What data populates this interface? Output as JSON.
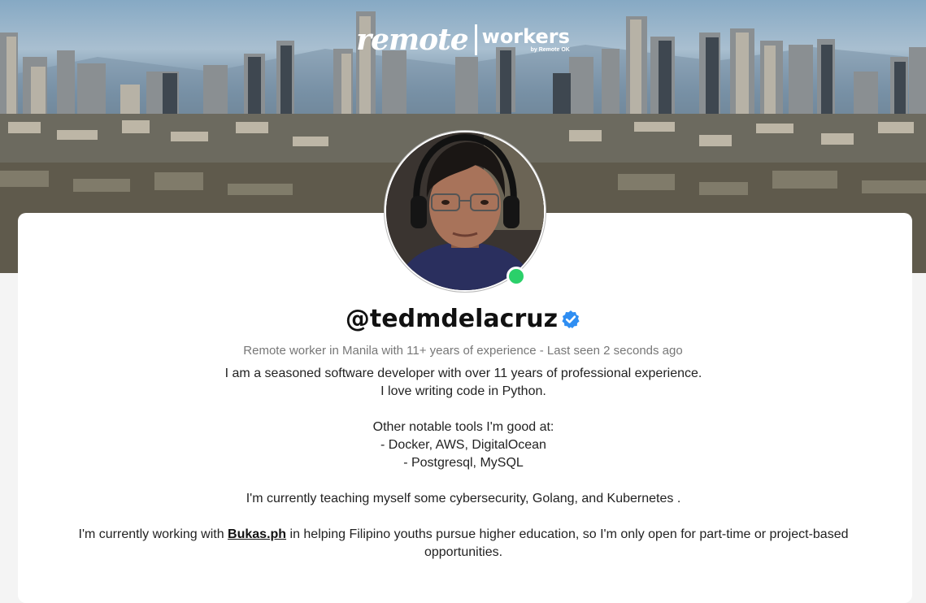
{
  "brand": {
    "remote": "remote",
    "workers": "workers",
    "by": "by Remote OK"
  },
  "profile": {
    "username": "@tedmdelacruz",
    "verified": true,
    "online": true,
    "subtitle": "Remote worker in Manila with 11+ years of experience - Last seen 2 seconds ago"
  },
  "bio": {
    "line1": "I am a seasoned software developer with over 11 years of professional experience.",
    "line2": "I love writing code in Python.",
    "line3": "Other notable tools I'm good at:",
    "line4": "- Docker, AWS, DigitalOcean",
    "line5": "- Postgresql, MySQL",
    "line6": "I'm currently teaching myself some cybersecurity, Golang, and Kubernetes .",
    "line7_before": "I'm currently working with ",
    "line7_link": "Bukas.ph",
    "line7_after": " in helping Filipino youths pursue higher education, so I'm only open for part-time or project-based opportunities."
  },
  "colors": {
    "online_dot": "#2bd06a",
    "verified_badge": "#2f8ef2"
  },
  "icons": {
    "verified": "verified-badge-icon",
    "online": "online-status-dot"
  }
}
